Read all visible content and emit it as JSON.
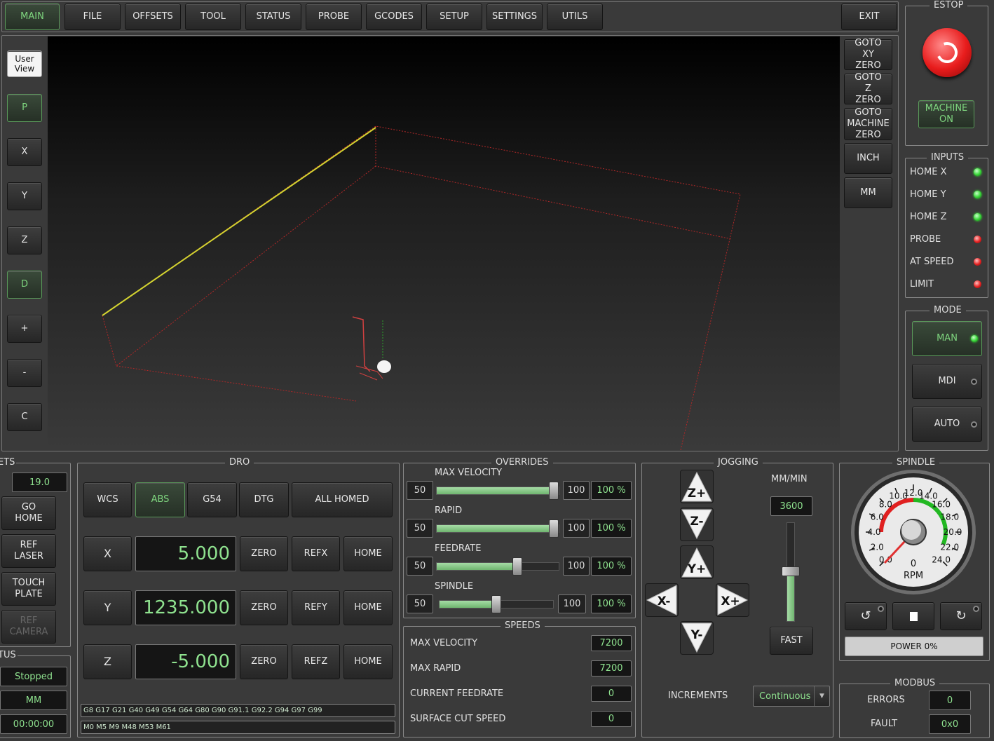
{
  "tabs": [
    "MAIN",
    "FILE",
    "OFFSETS",
    "TOOL",
    "STATUS",
    "PROBE",
    "GCODES",
    "SETUP",
    "SETTINGS",
    "UTILS"
  ],
  "exit_label": "EXIT",
  "estop": {
    "title": "ESTOP",
    "machine_on": "MACHINE ON"
  },
  "inputs": {
    "title": "INPUTS",
    "items": [
      {
        "label": "HOME X",
        "state": "green"
      },
      {
        "label": "HOME Y",
        "state": "green"
      },
      {
        "label": "HOME Z",
        "state": "green"
      },
      {
        "label": "PROBE",
        "state": "red"
      },
      {
        "label": "AT SPEED",
        "state": "red"
      },
      {
        "label": "LIMIT",
        "state": "red"
      }
    ]
  },
  "mode": {
    "title": "MODE",
    "items": [
      {
        "label": "MAN",
        "active": true
      },
      {
        "label": "MDI",
        "active": false
      },
      {
        "label": "AUTO",
        "active": false
      }
    ]
  },
  "view_buttons": {
    "user_view": "User View",
    "items": [
      "P",
      "X",
      "Y",
      "Z",
      "D",
      "+",
      "-",
      "C"
    ]
  },
  "goto_buttons": [
    "GOTO XY ZERO",
    "GOTO Z ZERO",
    "GOTO MACHINE ZERO",
    "INCH",
    "MM"
  ],
  "left_panel": {
    "title": "ETS",
    "value": "19.0",
    "buttons": [
      "GO HOME",
      "REF LASER",
      "TOUCH PLATE",
      "REF CAMERA"
    ]
  },
  "status_panel": {
    "title": "TUS",
    "state": "Stopped",
    "units": "MM",
    "time": "00:00:00"
  },
  "dro": {
    "title": "DRO",
    "top_buttons": [
      "WCS",
      "ABS",
      "G54",
      "DTG",
      "ALL HOMED"
    ],
    "axes": [
      {
        "axis": "X",
        "value": "5.000",
        "ref": "REFX"
      },
      {
        "axis": "Y",
        "value": "1235.000",
        "ref": "REFY"
      },
      {
        "axis": "Z",
        "value": "-5.000",
        "ref": "REFZ"
      }
    ],
    "zero_label": "ZERO",
    "home_label": "HOME",
    "gcodes": "G8 G17 G21 G40 G49 G54 G64 G80 G90 G91.1 G92.2 G94 G97 G99",
    "mcodes": "M0 M5 M9 M48 M53 M61"
  },
  "overrides": {
    "title": "OVERRIDES",
    "items": [
      {
        "label": "MAX VELOCITY",
        "min": "50",
        "max": "100",
        "value": "100 %",
        "fraction": 1.0
      },
      {
        "label": "RAPID",
        "min": "50",
        "max": "100",
        "value": "100 %",
        "fraction": 1.0
      },
      {
        "label": "FEEDRATE",
        "min": "50",
        "max": "100",
        "value": "100 %",
        "fraction": 0.66
      },
      {
        "label": "SPINDLE",
        "min": "50",
        "max": "100",
        "value": "100 %",
        "fraction": 0.5
      }
    ]
  },
  "speeds": {
    "title": "SPEEDS",
    "items": [
      {
        "label": "MAX VELOCITY",
        "value": "7200"
      },
      {
        "label": "MAX RAPID",
        "value": "7200"
      },
      {
        "label": "CURRENT FEEDRATE",
        "value": "0"
      },
      {
        "label": "SURFACE CUT SPEED",
        "value": "0"
      }
    ]
  },
  "jogging": {
    "title": "JOGGING",
    "units": "MM/MIN",
    "rate": "3600",
    "fast": "FAST",
    "increments_label": "INCREMENTS",
    "increment": "Continuous",
    "buttons": {
      "zp": "Z+",
      "zm": "Z-",
      "yp": "Y+",
      "ym": "Y-",
      "xm": "X-",
      "xp": "X+"
    }
  },
  "spindle": {
    "title": "SPINDLE",
    "rpm_value": "0",
    "rpm_label": "RPM",
    "power": "POWER 0%",
    "ticks": [
      "0.0",
      "2.0",
      "4.0",
      "6.0",
      "8.0",
      "10.0",
      "12.0",
      "14.0",
      "16.0",
      "18.0",
      "20.0",
      "22.0",
      "24.0"
    ]
  },
  "modbus": {
    "title": "MODBUS",
    "errors_label": "ERRORS",
    "errors": "0",
    "fault_label": "FAULT",
    "fault": "0x0"
  },
  "colors": {
    "accent": "#7fd67f",
    "led_green": "#37d637",
    "led_red": "#e52020",
    "path": "#d4d430",
    "bounds": "#c03030"
  }
}
